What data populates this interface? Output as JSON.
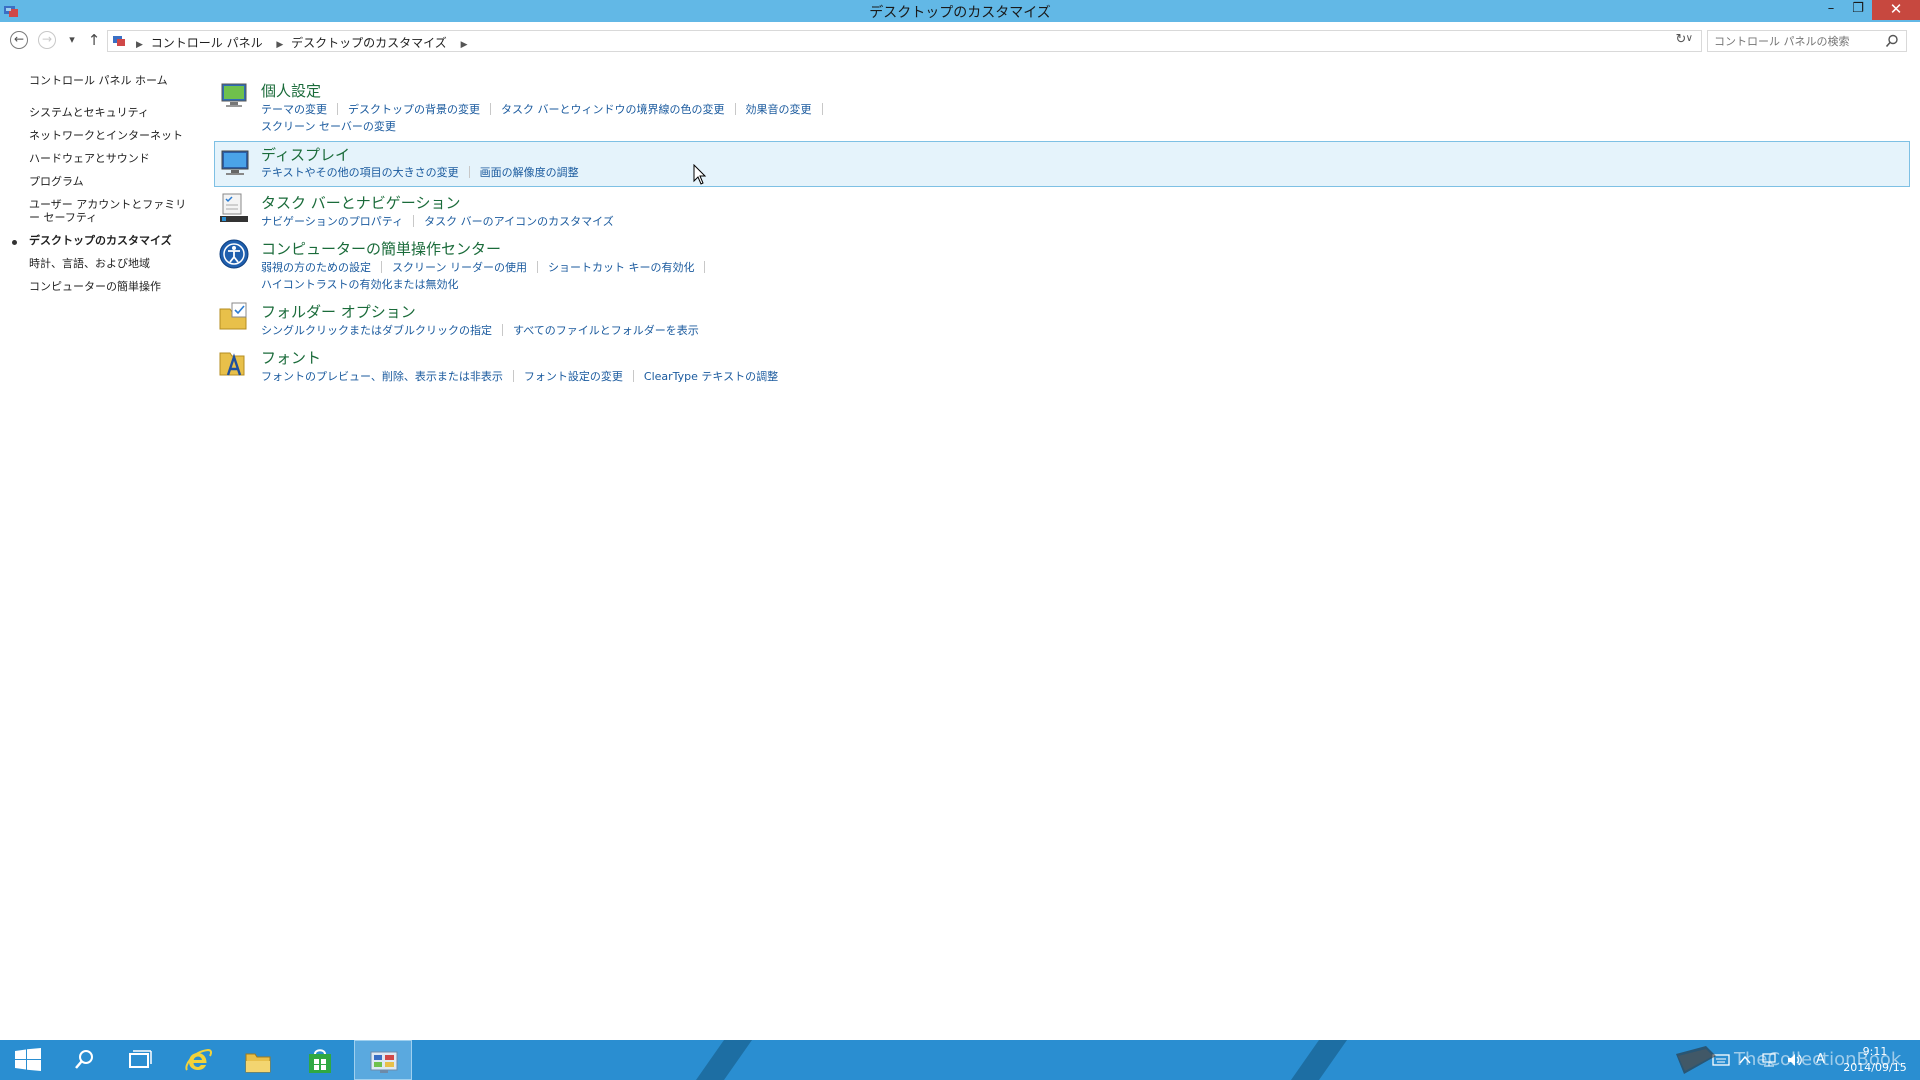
{
  "window": {
    "title": "デスクトップのカスタマイズ",
    "min_glyph": "–",
    "max_glyph": "❐",
    "close_glyph": "✕"
  },
  "nav": {
    "back_glyph": "←",
    "forward_glyph": "→",
    "recent_glyph": "▾",
    "up_glyph": "↑",
    "refresh_glyph": "↻",
    "address_dropdown_glyph": "∨",
    "breadcrumbs": [
      "コントロール パネル",
      "デスクトップのカスタマイズ"
    ],
    "crumb_separator": "▶",
    "search_placeholder": "コントロール パネルの検索"
  },
  "sidebar": {
    "items": [
      {
        "label": "コントロール パネル ホーム"
      },
      {
        "label": "システムとセキュリティ"
      },
      {
        "label": "ネットワークとインターネット"
      },
      {
        "label": "ハードウェアとサウンド"
      },
      {
        "label": "プログラム"
      },
      {
        "label": "ユーザー アカウントとファミリー セーフティ"
      },
      {
        "label": "デスクトップのカスタマイズ",
        "current": true
      },
      {
        "label": "時計、言語、および地域"
      },
      {
        "label": "コンピューターの簡単操作"
      }
    ]
  },
  "groups": [
    {
      "title": "個人設定",
      "icon": "personalization-icon",
      "link_rows": [
        [
          "テーマの変更",
          "デスクトップの背景の変更",
          "タスク バーとウィンドウの境界線の色の変更",
          "効果音の変更"
        ],
        [
          "スクリーン セーバーの変更"
        ]
      ]
    },
    {
      "title": "ディスプレイ",
      "icon": "display-icon",
      "hover": true,
      "link_rows": [
        [
          "テキストやその他の項目の大きさの変更",
          "画面の解像度の調整"
        ]
      ]
    },
    {
      "title": "タスク バーとナビゲーション",
      "icon": "taskbar-icon",
      "link_rows": [
        [
          "ナビゲーションのプロパティ",
          "タスク バーのアイコンのカスタマイズ"
        ]
      ]
    },
    {
      "title": "コンピューターの簡単操作センター",
      "icon": "ease-of-access-icon",
      "link_rows": [
        [
          "弱視の方のための設定",
          "スクリーン リーダーの使用",
          "ショートカット キーの有効化"
        ],
        [
          "ハイコントラストの有効化または無効化"
        ]
      ]
    },
    {
      "title": "フォルダー オプション",
      "icon": "folder-options-icon",
      "link_rows": [
        [
          "シングルクリックまたはダブルクリックの指定",
          "すべてのファイルとフォルダーを表示"
        ]
      ]
    },
    {
      "title": "フォント",
      "icon": "fonts-icon",
      "link_rows": [
        [
          "フォントのプレビュー、削除、表示または非表示",
          "フォント設定の変更",
          "ClearType テキストの調整"
        ]
      ]
    }
  ],
  "taskbar": {
    "apps": [
      "start-icon",
      "search-icon",
      "task-view-icon",
      "internet-explorer-icon",
      "file-explorer-icon",
      "store-icon",
      "control-panel-icon"
    ],
    "tray_ime_label": "A",
    "clock_time": "9:11",
    "clock_date": "2014/09/15"
  },
  "watermark": {
    "text": "TheCollectionBook"
  },
  "colors": {
    "titlebar": "#62b8e6",
    "taskbar": "#2a8ed1",
    "group_title": "#1a6b3a",
    "link": "#1a5a9e",
    "hover_bg": "#e5f3fb",
    "hover_border": "#7ec0e4"
  }
}
